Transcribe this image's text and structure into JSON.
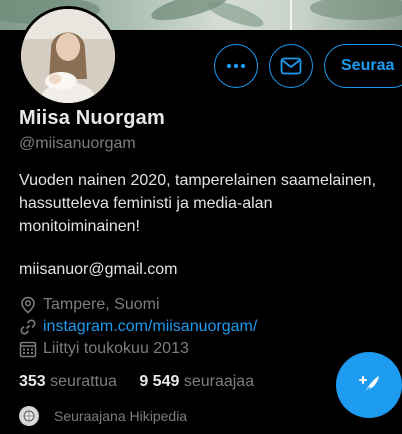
{
  "profile": {
    "name": "Miisa Nuorgam",
    "handle": "@miisanuorgam",
    "bio_lines": [
      "Vuoden nainen 2020, tamperelainen saamelainen,",
      "hassutteleva feministi ja media-alan",
      "monitoiminainen!"
    ],
    "email": "miisanuor@gmail.com",
    "location": "Tampere, Suomi",
    "website": "instagram.com/miisanuorgam/",
    "joined": "Liittyi toukokuu 2013"
  },
  "actions": {
    "more_icon": "more-dots-icon",
    "message_icon": "mail-icon",
    "follow_label": "Seuraa",
    "compose_icon": "compose-tweet-icon"
  },
  "stats": {
    "following_count": "353",
    "following_label": "seurattua",
    "followers_count": "9 549",
    "followers_label": "seuraajaa"
  },
  "followed_by": {
    "text": "Seuraajana Hikipedia"
  },
  "colors": {
    "accent": "#1d9bf0",
    "background": "#000000",
    "secondary_text": "#7d7d7d"
  }
}
